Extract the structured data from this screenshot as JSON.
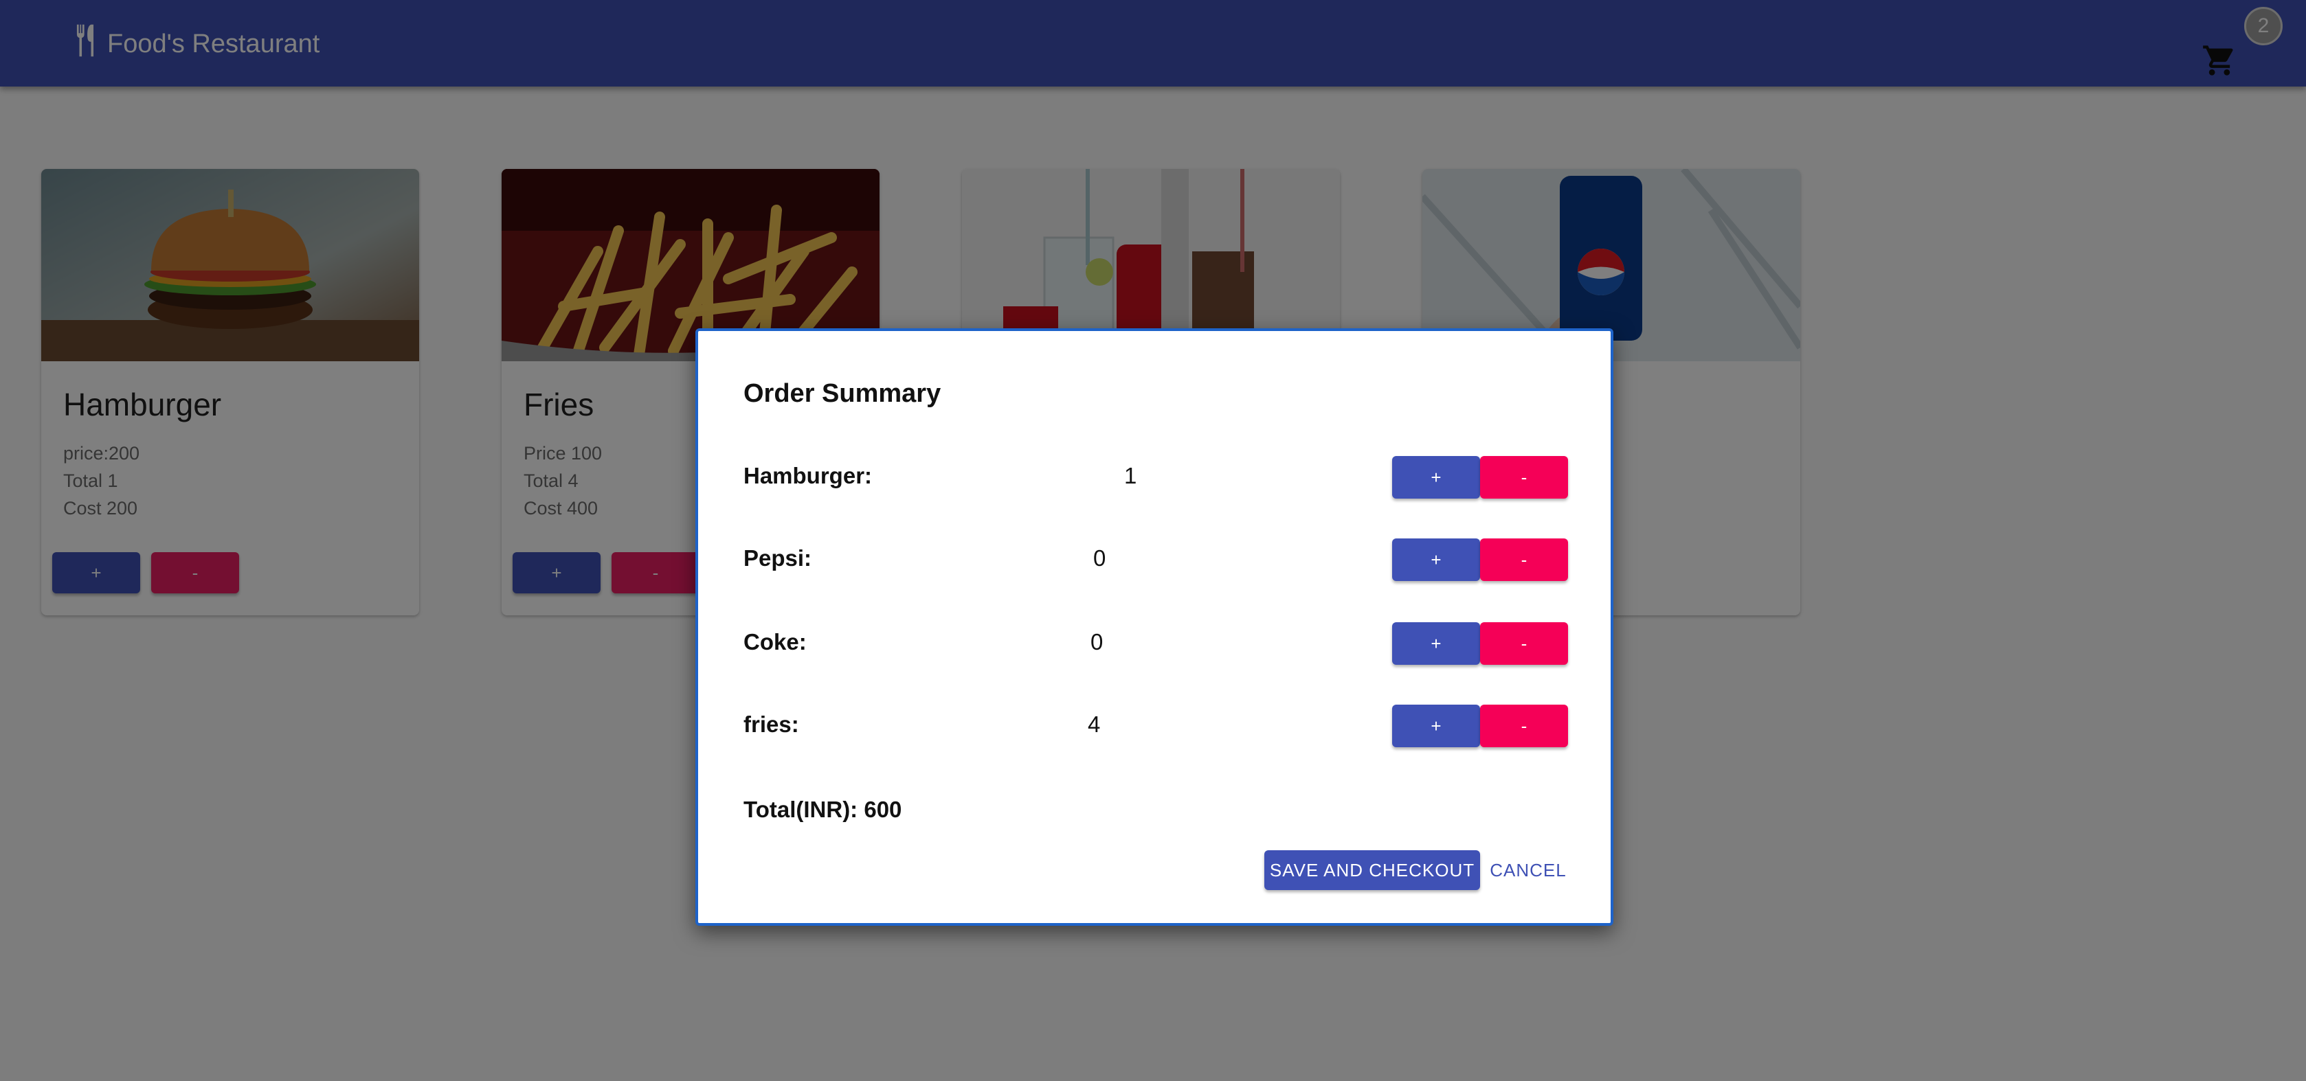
{
  "app": {
    "title": "Food's Restaurant",
    "cart_count": "2"
  },
  "cards": [
    {
      "name": "Hamburger",
      "line1": "price:200",
      "line2": "Total 1",
      "line3": "Cost 200",
      "plus": "+",
      "minus": "-"
    },
    {
      "name": "Fries",
      "line1": "Price 100",
      "line2": "Total 4",
      "line3": "Cost 400",
      "plus": "+",
      "minus": "-"
    },
    {
      "name": "",
      "line1": "",
      "line2": "",
      "line3": ""
    },
    {
      "name": "",
      "line1": "",
      "line2": "",
      "line3": ""
    }
  ],
  "dialog": {
    "title": "Order Summary",
    "items": [
      {
        "label": "Hamburger:",
        "qty": "1",
        "plus": "+",
        "minus": "-"
      },
      {
        "label": "Pepsi:",
        "qty": "0",
        "plus": "+",
        "minus": "-"
      },
      {
        "label": "Coke:",
        "qty": "0",
        "plus": "+",
        "minus": "-"
      },
      {
        "label": "fries:",
        "qty": "4",
        "plus": "+",
        "minus": "-"
      }
    ],
    "total": "Total(INR): 600",
    "save_label": "SAVE AND CHECKOUT",
    "cancel_label": "CANCEL"
  },
  "colors": {
    "primary": "#3f51b5",
    "secondary": "#f50057",
    "dialog_border": "#1e63c9"
  },
  "icons": {
    "brand": "fork-knife-icon",
    "cart": "shopping-cart-icon"
  }
}
